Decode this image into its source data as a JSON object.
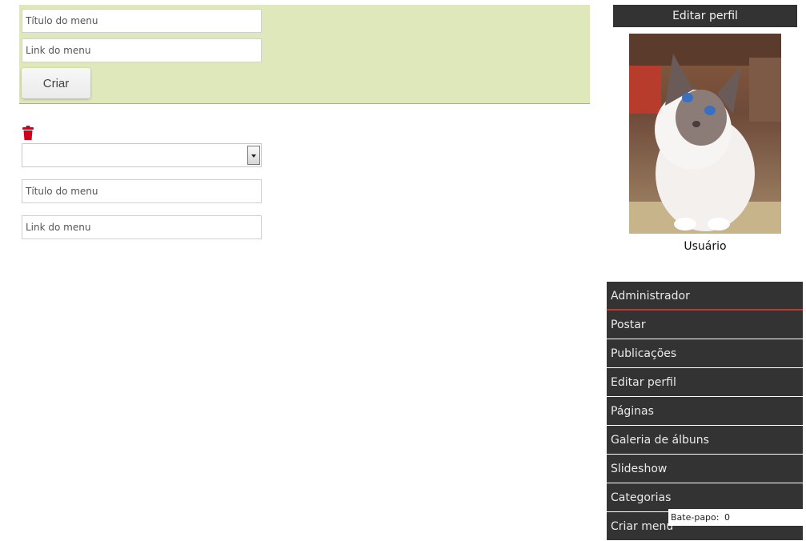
{
  "create_form": {
    "title_placeholder": "Título do menu",
    "link_placeholder": "Link do menu",
    "create_button": "Criar"
  },
  "edit_form": {
    "select_value": "",
    "title_placeholder": "Título do menu",
    "link_placeholder": "Link do menu"
  },
  "profile": {
    "edit_header": "Editar perfil",
    "username": "Usuário"
  },
  "side_menu": {
    "items": [
      {
        "label": "Administrador"
      },
      {
        "label": "Postar"
      },
      {
        "label": "Publicações"
      },
      {
        "label": "Editar perfil"
      },
      {
        "label": "Páginas"
      },
      {
        "label": "Galeria de álbuns"
      },
      {
        "label": "Slideshow"
      },
      {
        "label": "Categorias"
      },
      {
        "label": "Criar menu"
      }
    ]
  },
  "chat": {
    "label": "Bate-papo:",
    "count": "0"
  },
  "colors": {
    "panel_bg": "#dfe8bb",
    "menu_bg": "#333333",
    "active_underline": "#c0392b",
    "trash_red": "#d0021b"
  }
}
